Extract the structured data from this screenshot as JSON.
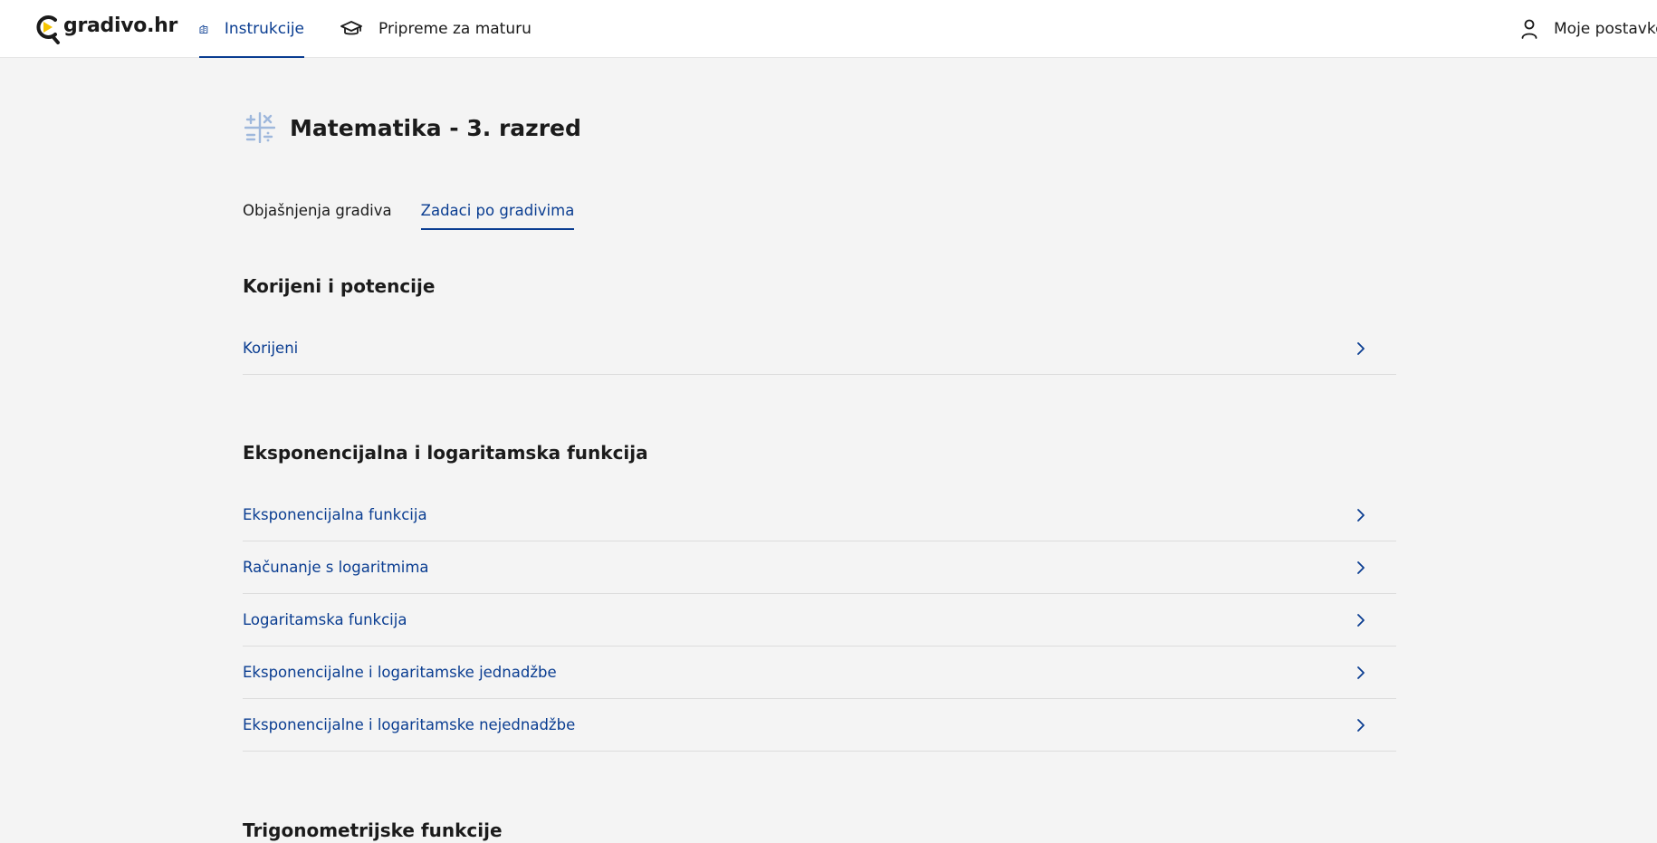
{
  "header": {
    "logo_text": "gradivo.hr",
    "nav": [
      {
        "label": "Instrukcije",
        "icon": "building-icon",
        "active": true
      },
      {
        "label": "Pripreme za maturu",
        "icon": "graduation-cap-icon",
        "active": false
      }
    ],
    "settings_label": "Moje postavke"
  },
  "page": {
    "title": "Matematika - 3. razred",
    "icon": "math-operators-icon",
    "tabs": [
      {
        "label": "Objašnjenja gradiva",
        "active": false
      },
      {
        "label": "Zadaci po gradivima",
        "active": true
      }
    ]
  },
  "sections": [
    {
      "title": "Korijeni i potencije",
      "items": [
        "Korijeni"
      ]
    },
    {
      "title": "Eksponencijalna i logaritamska funkcija",
      "items": [
        "Eksponencijalna funkcija",
        "Računanje s logaritmima",
        "Logaritamska funkcija",
        "Eksponencijalne i logaritamske jednadžbe",
        "Eksponencijalne i logaritamske nejednadžbe"
      ]
    },
    {
      "title": "Trigonometrijske funkcije",
      "items": []
    }
  ],
  "colors": {
    "accent": "#0a3d91",
    "background": "#f4f4f4",
    "logo_yellow": "#f5c400"
  }
}
